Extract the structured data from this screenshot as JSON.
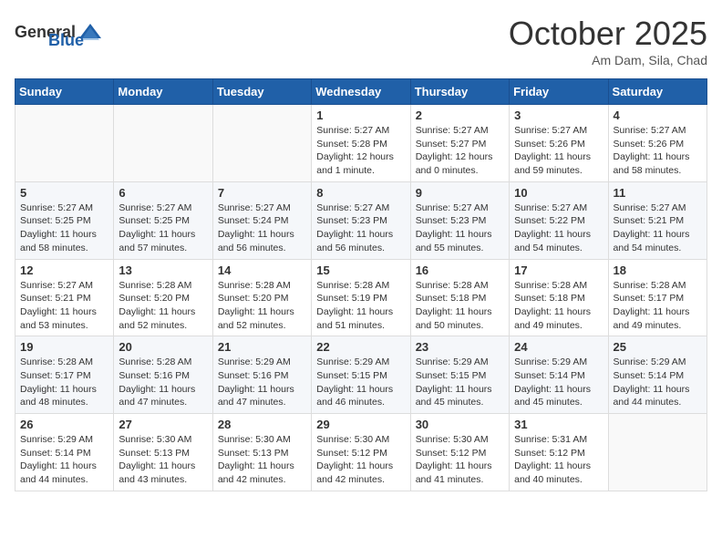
{
  "header": {
    "logo_general": "General",
    "logo_blue": "Blue",
    "month": "October 2025",
    "location": "Am Dam, Sila, Chad"
  },
  "weekdays": [
    "Sunday",
    "Monday",
    "Tuesday",
    "Wednesday",
    "Thursday",
    "Friday",
    "Saturday"
  ],
  "weeks": [
    [
      {
        "day": "",
        "info": ""
      },
      {
        "day": "",
        "info": ""
      },
      {
        "day": "",
        "info": ""
      },
      {
        "day": "1",
        "info": "Sunrise: 5:27 AM\nSunset: 5:28 PM\nDaylight: 12 hours\nand 1 minute."
      },
      {
        "day": "2",
        "info": "Sunrise: 5:27 AM\nSunset: 5:27 PM\nDaylight: 12 hours\nand 0 minutes."
      },
      {
        "day": "3",
        "info": "Sunrise: 5:27 AM\nSunset: 5:26 PM\nDaylight: 11 hours\nand 59 minutes."
      },
      {
        "day": "4",
        "info": "Sunrise: 5:27 AM\nSunset: 5:26 PM\nDaylight: 11 hours\nand 58 minutes."
      }
    ],
    [
      {
        "day": "5",
        "info": "Sunrise: 5:27 AM\nSunset: 5:25 PM\nDaylight: 11 hours\nand 58 minutes."
      },
      {
        "day": "6",
        "info": "Sunrise: 5:27 AM\nSunset: 5:25 PM\nDaylight: 11 hours\nand 57 minutes."
      },
      {
        "day": "7",
        "info": "Sunrise: 5:27 AM\nSunset: 5:24 PM\nDaylight: 11 hours\nand 56 minutes."
      },
      {
        "day": "8",
        "info": "Sunrise: 5:27 AM\nSunset: 5:23 PM\nDaylight: 11 hours\nand 56 minutes."
      },
      {
        "day": "9",
        "info": "Sunrise: 5:27 AM\nSunset: 5:23 PM\nDaylight: 11 hours\nand 55 minutes."
      },
      {
        "day": "10",
        "info": "Sunrise: 5:27 AM\nSunset: 5:22 PM\nDaylight: 11 hours\nand 54 minutes."
      },
      {
        "day": "11",
        "info": "Sunrise: 5:27 AM\nSunset: 5:21 PM\nDaylight: 11 hours\nand 54 minutes."
      }
    ],
    [
      {
        "day": "12",
        "info": "Sunrise: 5:27 AM\nSunset: 5:21 PM\nDaylight: 11 hours\nand 53 minutes."
      },
      {
        "day": "13",
        "info": "Sunrise: 5:28 AM\nSunset: 5:20 PM\nDaylight: 11 hours\nand 52 minutes."
      },
      {
        "day": "14",
        "info": "Sunrise: 5:28 AM\nSunset: 5:20 PM\nDaylight: 11 hours\nand 52 minutes."
      },
      {
        "day": "15",
        "info": "Sunrise: 5:28 AM\nSunset: 5:19 PM\nDaylight: 11 hours\nand 51 minutes."
      },
      {
        "day": "16",
        "info": "Sunrise: 5:28 AM\nSunset: 5:18 PM\nDaylight: 11 hours\nand 50 minutes."
      },
      {
        "day": "17",
        "info": "Sunrise: 5:28 AM\nSunset: 5:18 PM\nDaylight: 11 hours\nand 49 minutes."
      },
      {
        "day": "18",
        "info": "Sunrise: 5:28 AM\nSunset: 5:17 PM\nDaylight: 11 hours\nand 49 minutes."
      }
    ],
    [
      {
        "day": "19",
        "info": "Sunrise: 5:28 AM\nSunset: 5:17 PM\nDaylight: 11 hours\nand 48 minutes."
      },
      {
        "day": "20",
        "info": "Sunrise: 5:28 AM\nSunset: 5:16 PM\nDaylight: 11 hours\nand 47 minutes."
      },
      {
        "day": "21",
        "info": "Sunrise: 5:29 AM\nSunset: 5:16 PM\nDaylight: 11 hours\nand 47 minutes."
      },
      {
        "day": "22",
        "info": "Sunrise: 5:29 AM\nSunset: 5:15 PM\nDaylight: 11 hours\nand 46 minutes."
      },
      {
        "day": "23",
        "info": "Sunrise: 5:29 AM\nSunset: 5:15 PM\nDaylight: 11 hours\nand 45 minutes."
      },
      {
        "day": "24",
        "info": "Sunrise: 5:29 AM\nSunset: 5:14 PM\nDaylight: 11 hours\nand 45 minutes."
      },
      {
        "day": "25",
        "info": "Sunrise: 5:29 AM\nSunset: 5:14 PM\nDaylight: 11 hours\nand 44 minutes."
      }
    ],
    [
      {
        "day": "26",
        "info": "Sunrise: 5:29 AM\nSunset: 5:14 PM\nDaylight: 11 hours\nand 44 minutes."
      },
      {
        "day": "27",
        "info": "Sunrise: 5:30 AM\nSunset: 5:13 PM\nDaylight: 11 hours\nand 43 minutes."
      },
      {
        "day": "28",
        "info": "Sunrise: 5:30 AM\nSunset: 5:13 PM\nDaylight: 11 hours\nand 42 minutes."
      },
      {
        "day": "29",
        "info": "Sunrise: 5:30 AM\nSunset: 5:12 PM\nDaylight: 11 hours\nand 42 minutes."
      },
      {
        "day": "30",
        "info": "Sunrise: 5:30 AM\nSunset: 5:12 PM\nDaylight: 11 hours\nand 41 minutes."
      },
      {
        "day": "31",
        "info": "Sunrise: 5:31 AM\nSunset: 5:12 PM\nDaylight: 11 hours\nand 40 minutes."
      },
      {
        "day": "",
        "info": ""
      }
    ]
  ]
}
